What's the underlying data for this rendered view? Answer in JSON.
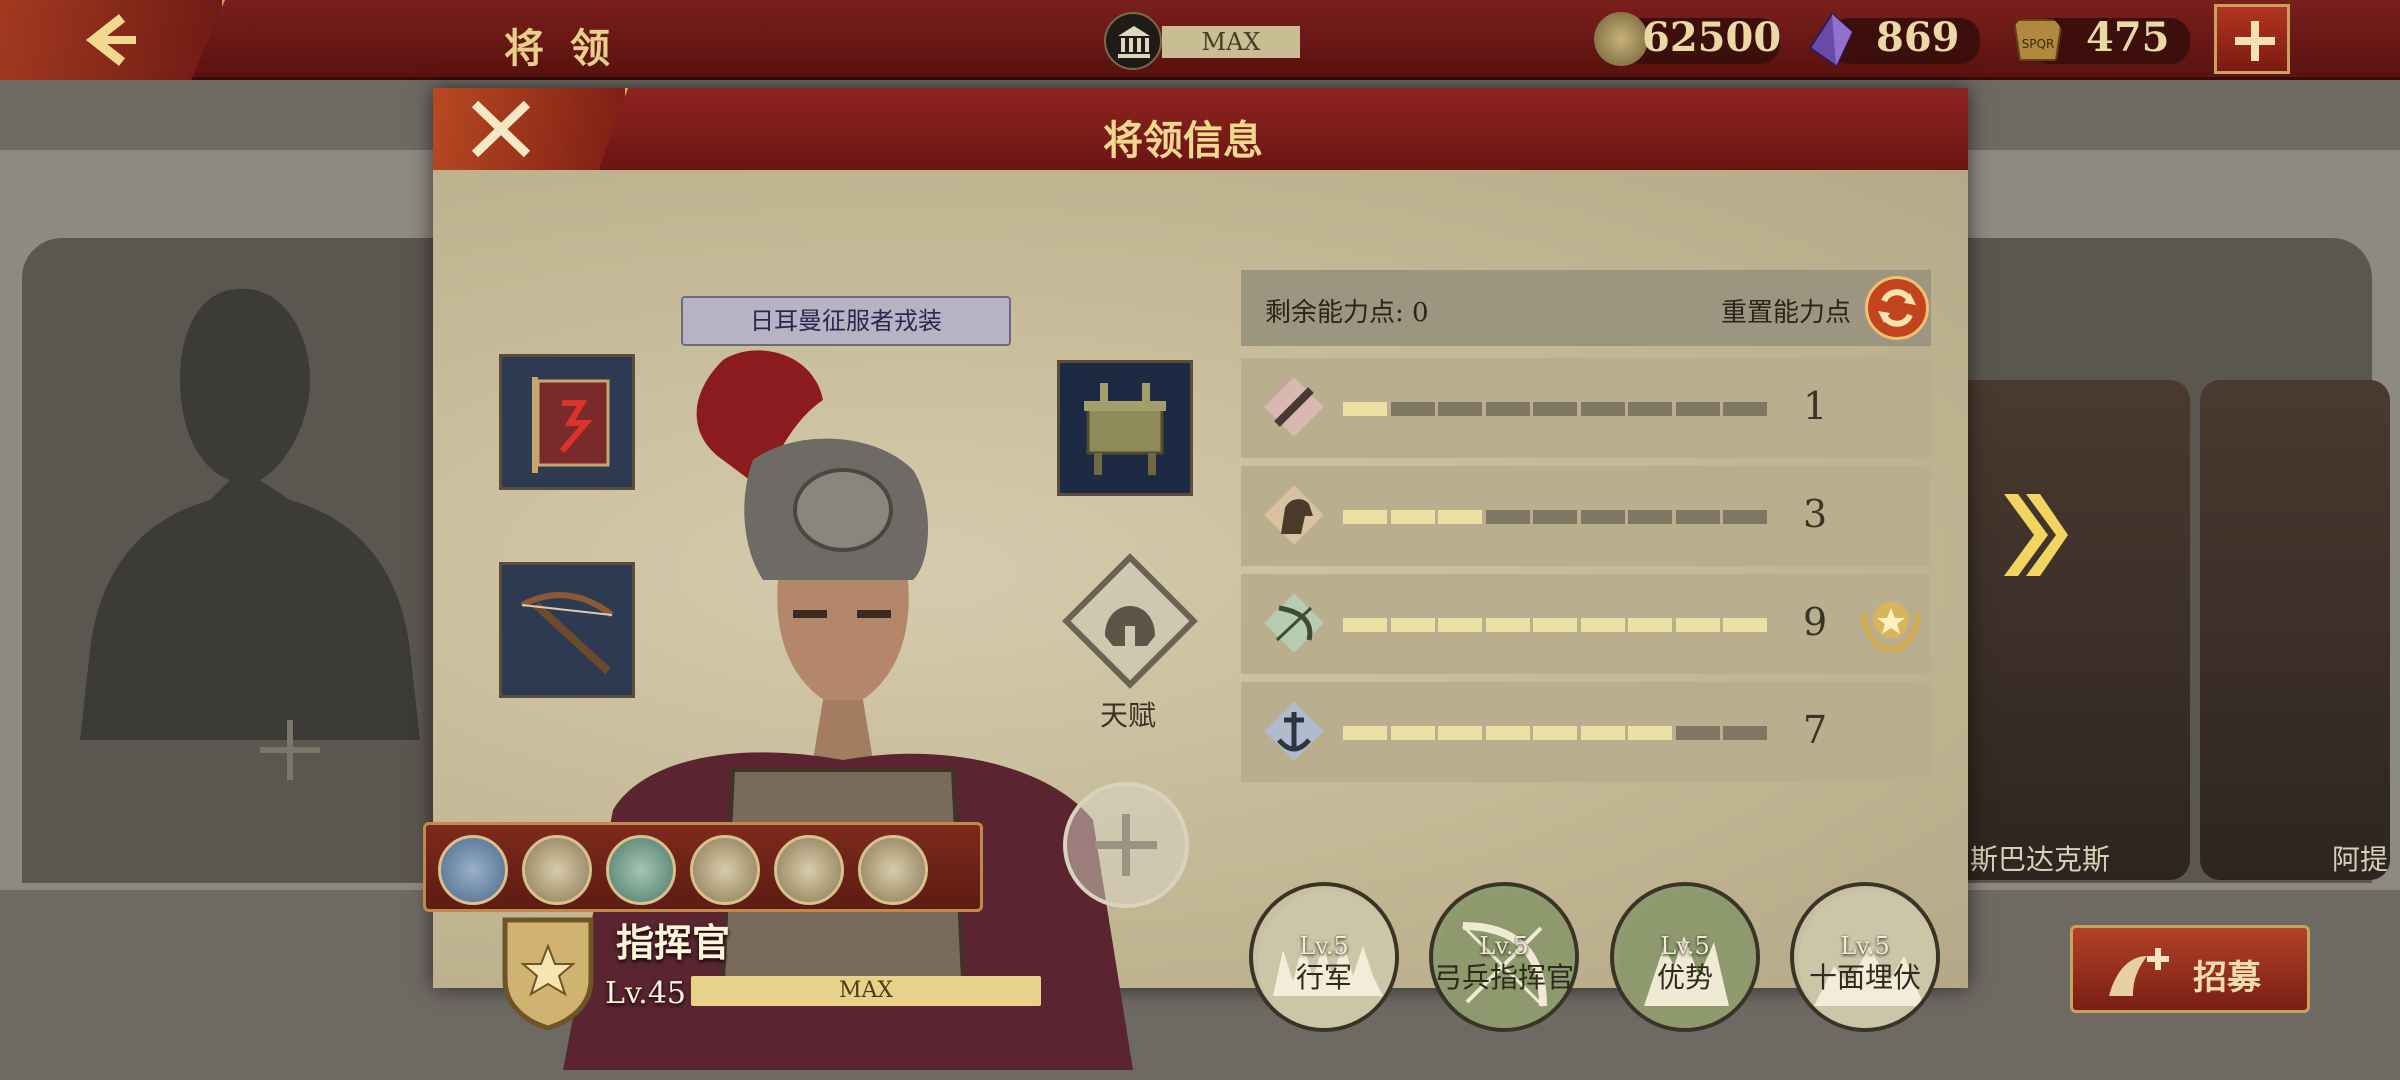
{
  "topbar": {
    "title": "将 领",
    "building_level": "MAX",
    "resources": [
      {
        "icon": "coin-icon",
        "value": "62500"
      },
      {
        "icon": "gem-icon",
        "value": "869"
      },
      {
        "icon": "spqr-token-icon",
        "value": "475"
      }
    ]
  },
  "background": {
    "hero_names": [
      "斯巴达克斯",
      "阿提"
    ],
    "recruit_label": "招募"
  },
  "panel": {
    "title": "将领信息",
    "skin_name": "日耳曼征服者戎装",
    "talent_label": "天赋",
    "rank": {
      "name": "指挥官",
      "level": "Lv.45",
      "bar_label": "MAX"
    },
    "points": {
      "remaining": "剩余能力点: 0",
      "reset": "重置能力点"
    },
    "stats": [
      {
        "icon": "sword-icon",
        "value": "1",
        "filled": 1,
        "max": 9
      },
      {
        "icon": "horse-icon",
        "value": "3",
        "filled": 3,
        "max": 9
      },
      {
        "icon": "bow-icon",
        "value": "9",
        "filled": 9,
        "max": 9
      },
      {
        "icon": "anchor-icon",
        "value": "7",
        "filled": 7,
        "max": 9
      }
    ],
    "skills": [
      {
        "level": "Lv.5",
        "name": "行军"
      },
      {
        "level": "Lv.5",
        "name": "弓兵指挥官"
      },
      {
        "level": "Lv.5",
        "name": "优势"
      },
      {
        "level": "Lv.5",
        "name": "十面埋伏"
      }
    ]
  },
  "colors": {
    "header_red": "#7a1f1c",
    "gold_text": "#f0d98f",
    "bar_on": "#ece0a4",
    "bar_off": "#7f7761"
  }
}
